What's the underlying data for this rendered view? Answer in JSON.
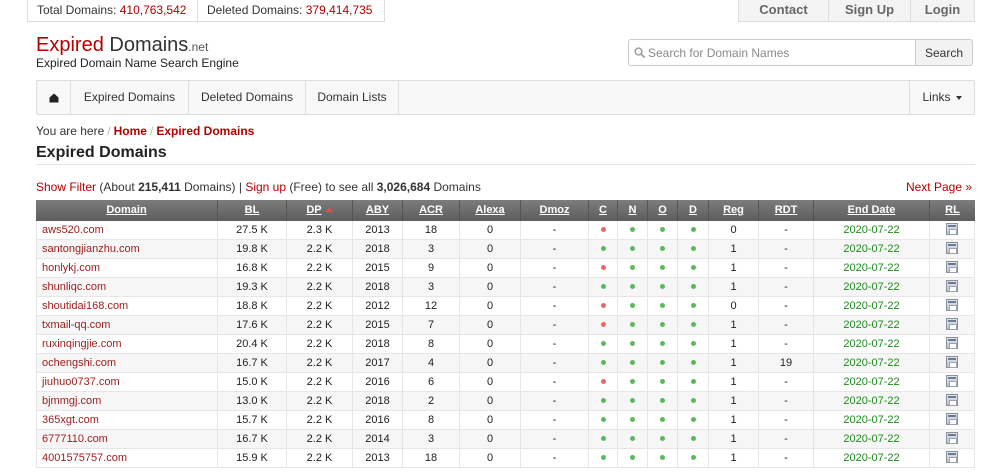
{
  "topbar": {
    "total_label": "Total Domains:",
    "total_value": "410,763,542",
    "deleted_label": "Deleted Domains:",
    "deleted_value": "379,414,735",
    "links": [
      "Contact",
      "Sign Up",
      "Login"
    ]
  },
  "logo": {
    "word1": "Expired",
    "word2": "Domains",
    "suffix": ".net",
    "tagline": "Expired Domain Name Search Engine"
  },
  "search": {
    "placeholder": "Search for Domain Names",
    "value": "",
    "button": "Search"
  },
  "nav": {
    "items": [
      "Expired Domains",
      "Deleted Domains",
      "Domain Lists"
    ],
    "links_label": "Links"
  },
  "breadcrumb": {
    "prefix": "You are here",
    "separator": "/",
    "home": "Home",
    "current": "Expired Domains"
  },
  "page_title": "Expired Domains",
  "filter": {
    "show_filter": "Show Filter",
    "about_prefix": "(About",
    "about_count": "215,411",
    "about_suffix": "Domains)",
    "divider": "|",
    "sign_up": "Sign up",
    "free_text": "(Free) to see all",
    "total_count": "3,026,684",
    "total_suffix": "Domains",
    "next_page": "Next Page »"
  },
  "table": {
    "columns": [
      "Domain",
      "BL",
      "DP",
      "ABY",
      "ACR",
      "Alexa",
      "Dmoz",
      "C",
      "N",
      "O",
      "D",
      "Reg",
      "RDT",
      "End Date",
      "RL"
    ],
    "rows": [
      {
        "domain": "aws520.com",
        "bl": "27.5 K",
        "dp": "2.3 K",
        "aby": "2013",
        "acr": "18",
        "alexa": "0",
        "dmoz": "-",
        "c": "red",
        "n": "green",
        "o": "green",
        "d": "green",
        "reg": "0",
        "rdt": "-",
        "end_date": "2020-07-22"
      },
      {
        "domain": "santongjianzhu.com",
        "bl": "19.8 K",
        "dp": "2.2 K",
        "aby": "2018",
        "acr": "3",
        "alexa": "0",
        "dmoz": "-",
        "c": "green",
        "n": "green",
        "o": "green",
        "d": "green",
        "reg": "1",
        "rdt": "-",
        "end_date": "2020-07-22"
      },
      {
        "domain": "honlykj.com",
        "bl": "16.8 K",
        "dp": "2.2 K",
        "aby": "2015",
        "acr": "9",
        "alexa": "0",
        "dmoz": "-",
        "c": "red",
        "n": "green",
        "o": "green",
        "d": "green",
        "reg": "1",
        "rdt": "-",
        "end_date": "2020-07-22"
      },
      {
        "domain": "shunliqc.com",
        "bl": "19.3 K",
        "dp": "2.2 K",
        "aby": "2018",
        "acr": "3",
        "alexa": "0",
        "dmoz": "-",
        "c": "green",
        "n": "green",
        "o": "green",
        "d": "green",
        "reg": "1",
        "rdt": "-",
        "end_date": "2020-07-22"
      },
      {
        "domain": "shoutidai168.com",
        "bl": "18.8 K",
        "dp": "2.2 K",
        "aby": "2012",
        "acr": "12",
        "alexa": "0",
        "dmoz": "-",
        "c": "red",
        "n": "green",
        "o": "green",
        "d": "green",
        "reg": "0",
        "rdt": "-",
        "end_date": "2020-07-22"
      },
      {
        "domain": "txmail-qq.com",
        "bl": "17.6 K",
        "dp": "2.2 K",
        "aby": "2015",
        "acr": "7",
        "alexa": "0",
        "dmoz": "-",
        "c": "red",
        "n": "green",
        "o": "green",
        "d": "green",
        "reg": "1",
        "rdt": "-",
        "end_date": "2020-07-22"
      },
      {
        "domain": "ruxinqingjie.com",
        "bl": "20.4 K",
        "dp": "2.2 K",
        "aby": "2018",
        "acr": "8",
        "alexa": "0",
        "dmoz": "-",
        "c": "green",
        "n": "green",
        "o": "green",
        "d": "green",
        "reg": "1",
        "rdt": "-",
        "end_date": "2020-07-22"
      },
      {
        "domain": "ochengshi.com",
        "bl": "16.7 K",
        "dp": "2.2 K",
        "aby": "2017",
        "acr": "4",
        "alexa": "0",
        "dmoz": "-",
        "c": "green",
        "n": "green",
        "o": "green",
        "d": "green",
        "reg": "1",
        "rdt": "19",
        "end_date": "2020-07-22"
      },
      {
        "domain": "jiuhuo0737.com",
        "bl": "15.0 K",
        "dp": "2.2 K",
        "aby": "2016",
        "acr": "6",
        "alexa": "0",
        "dmoz": "-",
        "c": "red",
        "n": "green",
        "o": "green",
        "d": "green",
        "reg": "1",
        "rdt": "-",
        "end_date": "2020-07-22"
      },
      {
        "domain": "bjmmgj.com",
        "bl": "13.0 K",
        "dp": "2.2 K",
        "aby": "2018",
        "acr": "2",
        "alexa": "0",
        "dmoz": "-",
        "c": "green",
        "n": "green",
        "o": "green",
        "d": "green",
        "reg": "1",
        "rdt": "-",
        "end_date": "2020-07-22"
      },
      {
        "domain": "365xgt.com",
        "bl": "15.7 K",
        "dp": "2.2 K",
        "aby": "2016",
        "acr": "8",
        "alexa": "0",
        "dmoz": "-",
        "c": "green",
        "n": "green",
        "o": "green",
        "d": "green",
        "reg": "1",
        "rdt": "-",
        "end_date": "2020-07-22"
      },
      {
        "domain": "6777110.com",
        "bl": "16.7 K",
        "dp": "2.2 K",
        "aby": "2014",
        "acr": "3",
        "alexa": "0",
        "dmoz": "-",
        "c": "green",
        "n": "green",
        "o": "green",
        "d": "green",
        "reg": "1",
        "rdt": "-",
        "end_date": "2020-07-22"
      },
      {
        "domain": "4001575757.com",
        "bl": "15.9 K",
        "dp": "2.2 K",
        "aby": "2013",
        "acr": "18",
        "alexa": "0",
        "dmoz": "-",
        "c": "green",
        "n": "green",
        "o": "green",
        "d": "green",
        "reg": "1",
        "rdt": "-",
        "end_date": "2020-07-22"
      }
    ]
  },
  "colors": {
    "brand_red": "#b30000",
    "domain_link": "#9b1c1c",
    "status_red": "#e26a6a",
    "status_green": "#5cb85c",
    "end_date": "#1e8a1e",
    "header_bg": "#6a6a6a"
  },
  "icons": {
    "home": "home-icon",
    "search": "search-icon",
    "links_caret": "caret-down-icon",
    "sort_asc": "sort-asc-icon",
    "rl_preview": "page-preview-icon"
  }
}
